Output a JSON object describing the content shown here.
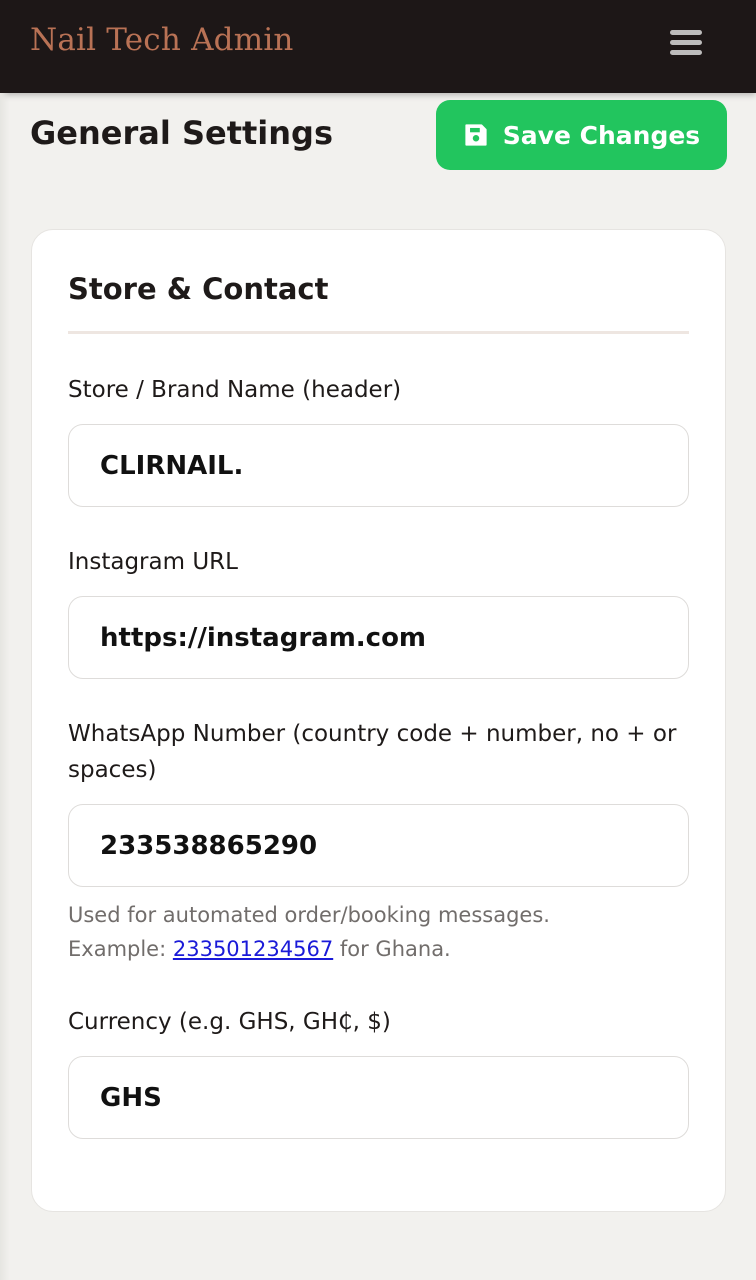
{
  "header": {
    "app_title": "Nail Tech Admin",
    "menu_icon": "hamburger-menu-icon"
  },
  "page": {
    "title": "General Settings",
    "save_label": "Save Changes",
    "save_icon": "floppy-disk-icon",
    "save_color": "#22c55e"
  },
  "section": {
    "title": "Store & Contact",
    "fields": {
      "brand_name": {
        "label": "Store / Brand Name (header)",
        "value": "CLIRNAIL."
      },
      "instagram": {
        "label": "Instagram URL",
        "value": "https://instagram.com"
      },
      "whatsapp": {
        "label": "WhatsApp Number (country code + number, no + or spaces)",
        "value": "233538865290",
        "help_line1": "Used for automated order/booking messages.",
        "help_prefix": "Example: ",
        "help_example": "233501234567",
        "help_suffix": " for Ghana."
      },
      "currency": {
        "label": "Currency (e.g. GHS, GH₵, $)",
        "value": "GHS"
      }
    }
  },
  "colors": {
    "topbar": "#1d1717",
    "brand": "#b97255",
    "background": "#f2f1ee",
    "link": "#1a1ad8"
  }
}
